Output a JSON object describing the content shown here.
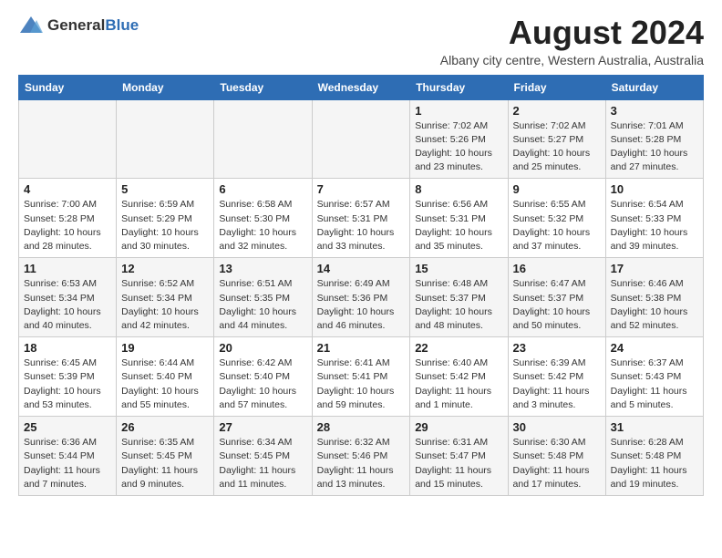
{
  "logo": {
    "general": "General",
    "blue": "Blue"
  },
  "title": "August 2024",
  "subtitle": "Albany city centre, Western Australia, Australia",
  "header": {
    "days": [
      "Sunday",
      "Monday",
      "Tuesday",
      "Wednesday",
      "Thursday",
      "Friday",
      "Saturday"
    ]
  },
  "weeks": [
    [
      {
        "num": "",
        "info": ""
      },
      {
        "num": "",
        "info": ""
      },
      {
        "num": "",
        "info": ""
      },
      {
        "num": "",
        "info": ""
      },
      {
        "num": "1",
        "info": "Sunrise: 7:02 AM\nSunset: 5:26 PM\nDaylight: 10 hours\nand 23 minutes."
      },
      {
        "num": "2",
        "info": "Sunrise: 7:02 AM\nSunset: 5:27 PM\nDaylight: 10 hours\nand 25 minutes."
      },
      {
        "num": "3",
        "info": "Sunrise: 7:01 AM\nSunset: 5:28 PM\nDaylight: 10 hours\nand 27 minutes."
      }
    ],
    [
      {
        "num": "4",
        "info": "Sunrise: 7:00 AM\nSunset: 5:28 PM\nDaylight: 10 hours\nand 28 minutes."
      },
      {
        "num": "5",
        "info": "Sunrise: 6:59 AM\nSunset: 5:29 PM\nDaylight: 10 hours\nand 30 minutes."
      },
      {
        "num": "6",
        "info": "Sunrise: 6:58 AM\nSunset: 5:30 PM\nDaylight: 10 hours\nand 32 minutes."
      },
      {
        "num": "7",
        "info": "Sunrise: 6:57 AM\nSunset: 5:31 PM\nDaylight: 10 hours\nand 33 minutes."
      },
      {
        "num": "8",
        "info": "Sunrise: 6:56 AM\nSunset: 5:31 PM\nDaylight: 10 hours\nand 35 minutes."
      },
      {
        "num": "9",
        "info": "Sunrise: 6:55 AM\nSunset: 5:32 PM\nDaylight: 10 hours\nand 37 minutes."
      },
      {
        "num": "10",
        "info": "Sunrise: 6:54 AM\nSunset: 5:33 PM\nDaylight: 10 hours\nand 39 minutes."
      }
    ],
    [
      {
        "num": "11",
        "info": "Sunrise: 6:53 AM\nSunset: 5:34 PM\nDaylight: 10 hours\nand 40 minutes."
      },
      {
        "num": "12",
        "info": "Sunrise: 6:52 AM\nSunset: 5:34 PM\nDaylight: 10 hours\nand 42 minutes."
      },
      {
        "num": "13",
        "info": "Sunrise: 6:51 AM\nSunset: 5:35 PM\nDaylight: 10 hours\nand 44 minutes."
      },
      {
        "num": "14",
        "info": "Sunrise: 6:49 AM\nSunset: 5:36 PM\nDaylight: 10 hours\nand 46 minutes."
      },
      {
        "num": "15",
        "info": "Sunrise: 6:48 AM\nSunset: 5:37 PM\nDaylight: 10 hours\nand 48 minutes."
      },
      {
        "num": "16",
        "info": "Sunrise: 6:47 AM\nSunset: 5:37 PM\nDaylight: 10 hours\nand 50 minutes."
      },
      {
        "num": "17",
        "info": "Sunrise: 6:46 AM\nSunset: 5:38 PM\nDaylight: 10 hours\nand 52 minutes."
      }
    ],
    [
      {
        "num": "18",
        "info": "Sunrise: 6:45 AM\nSunset: 5:39 PM\nDaylight: 10 hours\nand 53 minutes."
      },
      {
        "num": "19",
        "info": "Sunrise: 6:44 AM\nSunset: 5:40 PM\nDaylight: 10 hours\nand 55 minutes."
      },
      {
        "num": "20",
        "info": "Sunrise: 6:42 AM\nSunset: 5:40 PM\nDaylight: 10 hours\nand 57 minutes."
      },
      {
        "num": "21",
        "info": "Sunrise: 6:41 AM\nSunset: 5:41 PM\nDaylight: 10 hours\nand 59 minutes."
      },
      {
        "num": "22",
        "info": "Sunrise: 6:40 AM\nSunset: 5:42 PM\nDaylight: 11 hours\nand 1 minute."
      },
      {
        "num": "23",
        "info": "Sunrise: 6:39 AM\nSunset: 5:42 PM\nDaylight: 11 hours\nand 3 minutes."
      },
      {
        "num": "24",
        "info": "Sunrise: 6:37 AM\nSunset: 5:43 PM\nDaylight: 11 hours\nand 5 minutes."
      }
    ],
    [
      {
        "num": "25",
        "info": "Sunrise: 6:36 AM\nSunset: 5:44 PM\nDaylight: 11 hours\nand 7 minutes."
      },
      {
        "num": "26",
        "info": "Sunrise: 6:35 AM\nSunset: 5:45 PM\nDaylight: 11 hours\nand 9 minutes."
      },
      {
        "num": "27",
        "info": "Sunrise: 6:34 AM\nSunset: 5:45 PM\nDaylight: 11 hours\nand 11 minutes."
      },
      {
        "num": "28",
        "info": "Sunrise: 6:32 AM\nSunset: 5:46 PM\nDaylight: 11 hours\nand 13 minutes."
      },
      {
        "num": "29",
        "info": "Sunrise: 6:31 AM\nSunset: 5:47 PM\nDaylight: 11 hours\nand 15 minutes."
      },
      {
        "num": "30",
        "info": "Sunrise: 6:30 AM\nSunset: 5:48 PM\nDaylight: 11 hours\nand 17 minutes."
      },
      {
        "num": "31",
        "info": "Sunrise: 6:28 AM\nSunset: 5:48 PM\nDaylight: 11 hours\nand 19 minutes."
      }
    ]
  ]
}
